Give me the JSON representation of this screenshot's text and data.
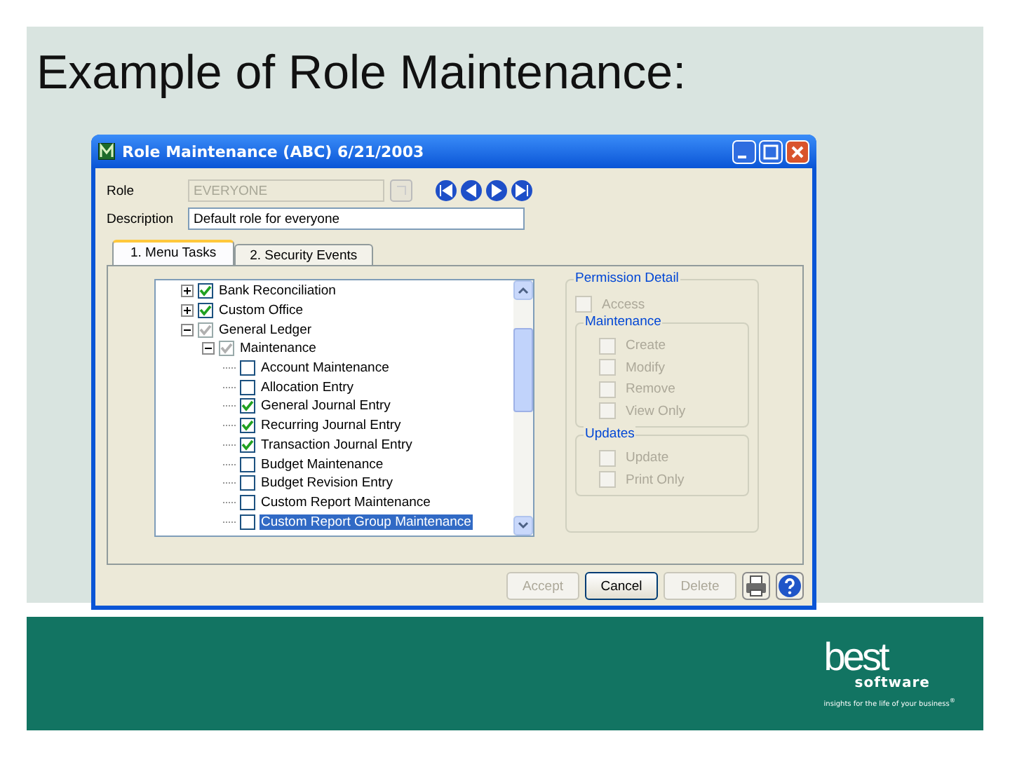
{
  "slide": {
    "title": "Example of Role Maintenance:"
  },
  "window": {
    "title": "Role Maintenance (ABC) 6/21/2003"
  },
  "form": {
    "role_label": "Role",
    "role_value": "EVERYONE",
    "description_label": "Description",
    "description_value": "Default role for everyone"
  },
  "tabs": [
    {
      "label": "1. Menu Tasks",
      "selected": true
    },
    {
      "label": "2. Security Events",
      "selected": false
    }
  ],
  "tree": [
    {
      "label": "Bank Reconciliation",
      "checked": true,
      "disabled": false,
      "expanded": false,
      "selected": false
    },
    {
      "label": "Custom Office",
      "checked": true,
      "disabled": false,
      "expanded": false,
      "selected": false
    },
    {
      "label": "General Ledger",
      "checked": true,
      "disabled": true,
      "expanded": true,
      "selected": false,
      "children": [
        {
          "label": "Maintenance",
          "checked": true,
          "disabled": true,
          "expanded": true,
          "selected": false,
          "children": [
            {
              "label": "Account Maintenance",
              "checked": false,
              "disabled": false,
              "selected": false
            },
            {
              "label": "Allocation Entry",
              "checked": false,
              "disabled": false,
              "selected": false
            },
            {
              "label": "General Journal Entry",
              "checked": true,
              "disabled": false,
              "selected": false
            },
            {
              "label": "Recurring Journal Entry",
              "checked": true,
              "disabled": false,
              "selected": false
            },
            {
              "label": "Transaction Journal Entry",
              "checked": true,
              "disabled": false,
              "selected": false
            },
            {
              "label": "Budget Maintenance",
              "checked": false,
              "disabled": false,
              "selected": false
            },
            {
              "label": "Budget Revision Entry",
              "checked": false,
              "disabled": false,
              "selected": false
            },
            {
              "label": "Custom Report Maintenance",
              "checked": false,
              "disabled": false,
              "selected": false
            },
            {
              "label": "Custom Report Group Maintenance",
              "checked": false,
              "disabled": false,
              "selected": true
            }
          ]
        }
      ]
    }
  ],
  "permission": {
    "title": "Permission Detail",
    "access": {
      "label": "Access",
      "checked": false,
      "disabled": true
    },
    "groups": [
      {
        "title": "Maintenance",
        "items": [
          {
            "label": "Create",
            "checked": false,
            "disabled": true
          },
          {
            "label": "Modify",
            "checked": false,
            "disabled": true
          },
          {
            "label": "Remove",
            "checked": false,
            "disabled": true
          },
          {
            "label": "View Only",
            "checked": false,
            "disabled": true
          }
        ]
      },
      {
        "title": "Updates",
        "items": [
          {
            "label": "Update",
            "checked": false,
            "disabled": true
          },
          {
            "label": "Print Only",
            "checked": false,
            "disabled": true
          }
        ]
      }
    ]
  },
  "buttons": [
    {
      "label": "Accept",
      "disabled": true
    },
    {
      "label": "Cancel",
      "disabled": false
    },
    {
      "label": "Delete",
      "disabled": true
    }
  ],
  "logo": {
    "wordmark": "best",
    "sub": "software",
    "tagline": "insights for the life of your business$^{®}$"
  }
}
